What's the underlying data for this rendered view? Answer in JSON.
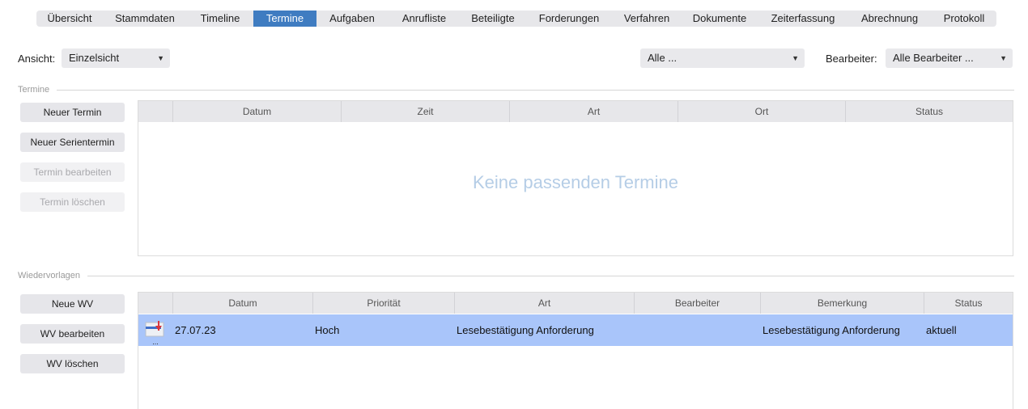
{
  "tabs": [
    {
      "label": "Übersicht",
      "active": false
    },
    {
      "label": "Stammdaten",
      "active": false
    },
    {
      "label": "Timeline",
      "active": false
    },
    {
      "label": "Termine",
      "active": true
    },
    {
      "label": "Aufgaben",
      "active": false
    },
    {
      "label": "Anrufliste",
      "active": false
    },
    {
      "label": "Beteiligte",
      "active": false
    },
    {
      "label": "Forderungen",
      "active": false
    },
    {
      "label": "Verfahren",
      "active": false
    },
    {
      "label": "Dokumente",
      "active": false
    },
    {
      "label": "Zeiterfassung",
      "active": false
    },
    {
      "label": "Abrechnung",
      "active": false
    },
    {
      "label": "Protokoll",
      "active": false
    }
  ],
  "filter": {
    "ansicht_label": "Ansicht:",
    "ansicht_value": "Einzelsicht",
    "type_value": "Alle ...",
    "bearbeiter_label": "Bearbeiter:",
    "bearbeiter_value": "Alle Bearbeiter ..."
  },
  "termine": {
    "section_title": "Termine",
    "buttons": {
      "new": "Neuer Termin",
      "new_series": "Neuer Serientermin",
      "edit": "Termin bearbeiten",
      "delete": "Termin löschen"
    },
    "columns": [
      "Datum",
      "Zeit",
      "Art",
      "Ort",
      "Status"
    ],
    "empty_message": "Keine passenden Termine"
  },
  "wiedervorlagen": {
    "section_title": "Wiedervorlagen",
    "buttons": {
      "new": "Neue WV",
      "edit": "WV bearbeiten",
      "delete": "WV löschen"
    },
    "columns": [
      "Datum",
      "Priorität",
      "Art",
      "Bearbeiter",
      "Bemerkung",
      "Status"
    ],
    "rows": [
      {
        "icon": "calendar-flag-icon",
        "datum": "27.07.23",
        "prioritaet": "Hoch",
        "art": "Lesebestätigung Anforderung",
        "bearbeiter": "",
        "bemerkung": "Lesebestätigung Anforderung",
        "status": "aktuell"
      }
    ]
  },
  "colors": {
    "tab_active": "#3f7cc1",
    "row_selected": "#a9c5fa",
    "empty_message": "#b5cde6",
    "icon_flag": "#d9363e",
    "icon_bar": "#3f6fc9"
  }
}
